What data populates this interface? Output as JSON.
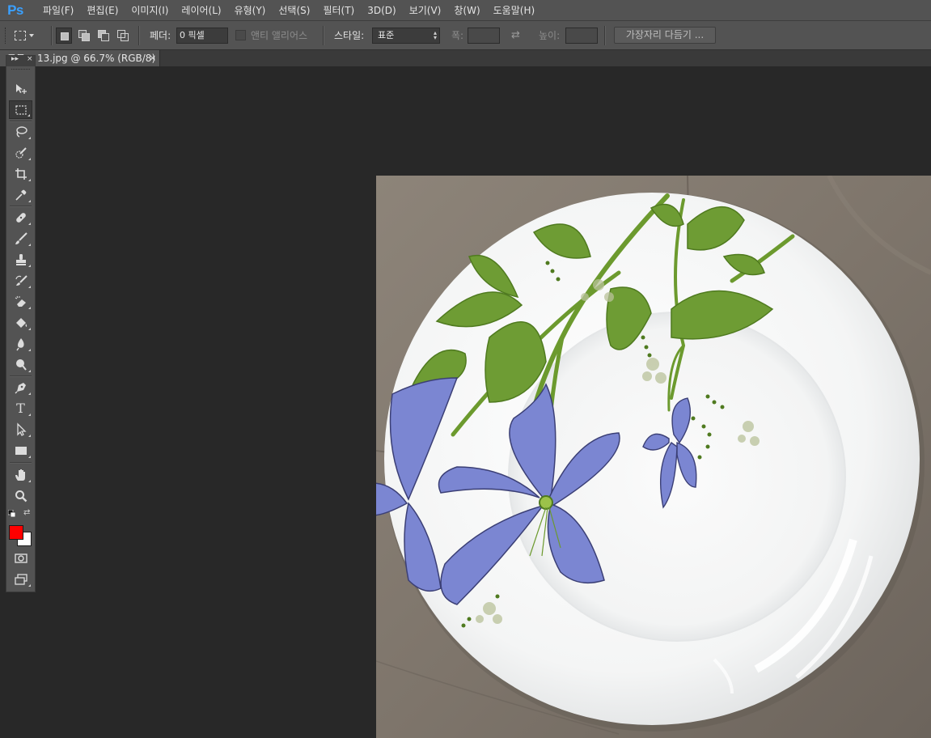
{
  "app": {
    "logo": "Ps"
  },
  "menu": [
    {
      "label": "파일(F)"
    },
    {
      "label": "편집(E)"
    },
    {
      "label": "이미지(I)"
    },
    {
      "label": "레이어(L)"
    },
    {
      "label": "유형(Y)"
    },
    {
      "label": "선택(S)"
    },
    {
      "label": "필터(T)"
    },
    {
      "label": "3D(D)"
    },
    {
      "label": "보기(V)"
    },
    {
      "label": "창(W)"
    },
    {
      "label": "도움말(H)"
    }
  ],
  "options": {
    "feather_label": "페더:",
    "feather_value": "0 픽셀",
    "anti_alias_label": "앤티 앨리어스",
    "anti_alias_checked": false,
    "style_label": "스타일:",
    "style_value": "표준",
    "width_label": "폭:",
    "width_value": "",
    "height_label": "높이:",
    "height_value": "",
    "refine_edge_button": "가장자리 다듬기 ..."
  },
  "document_tab": {
    "title": "13.jpg @ 66.7% (RGB/8)",
    "close": "×",
    "hidden_prefix": "그도"
  },
  "toolbox": {
    "collapse_glyph": "▸▸",
    "close_glyph": "×",
    "tools": [
      {
        "name": "move-tool",
        "icon": "move-icon"
      },
      {
        "name": "rectangular-marquee-tool",
        "icon": "marquee-icon",
        "active": true
      },
      {
        "name": "lasso-tool",
        "icon": "lasso-icon"
      },
      {
        "name": "quick-selection-tool",
        "icon": "quick-selection-icon"
      },
      {
        "name": "crop-tool",
        "icon": "crop-icon"
      },
      {
        "name": "eyedropper-tool",
        "icon": "eyedropper-icon"
      },
      {
        "name": "healing-brush-tool",
        "icon": "bandage-icon"
      },
      {
        "name": "brush-tool",
        "icon": "brush-icon"
      },
      {
        "name": "clone-stamp-tool",
        "icon": "stamp-icon"
      },
      {
        "name": "history-brush-tool",
        "icon": "history-brush-icon"
      },
      {
        "name": "eraser-tool",
        "icon": "eraser-icon"
      },
      {
        "name": "paint-bucket-tool",
        "icon": "bucket-icon"
      },
      {
        "name": "blur-tool",
        "icon": "blur-icon"
      },
      {
        "name": "dodge-tool",
        "icon": "dodge-icon"
      },
      {
        "name": "pen-tool",
        "icon": "pen-icon"
      },
      {
        "name": "type-tool",
        "icon": "type-icon"
      },
      {
        "name": "path-selection-tool",
        "icon": "path-selection-icon"
      },
      {
        "name": "rectangle-tool",
        "icon": "rectangle-icon"
      },
      {
        "name": "hand-tool",
        "icon": "hand-icon"
      },
      {
        "name": "zoom-tool",
        "icon": "zoom-icon"
      }
    ],
    "type_glyph": "T",
    "swap_glyph": "⇄",
    "foreground_color": "#ff0000",
    "background_color": "#ffffff"
  },
  "canvas": {
    "image_subject": "white porcelain plate with painted blue flowers and green leaves on a grey leather surface",
    "zoom": "66.7%",
    "mode": "RGB/8"
  },
  "colors": {
    "chrome": "#535353",
    "workspace": "#282828",
    "accent": "#3aa0ff"
  }
}
